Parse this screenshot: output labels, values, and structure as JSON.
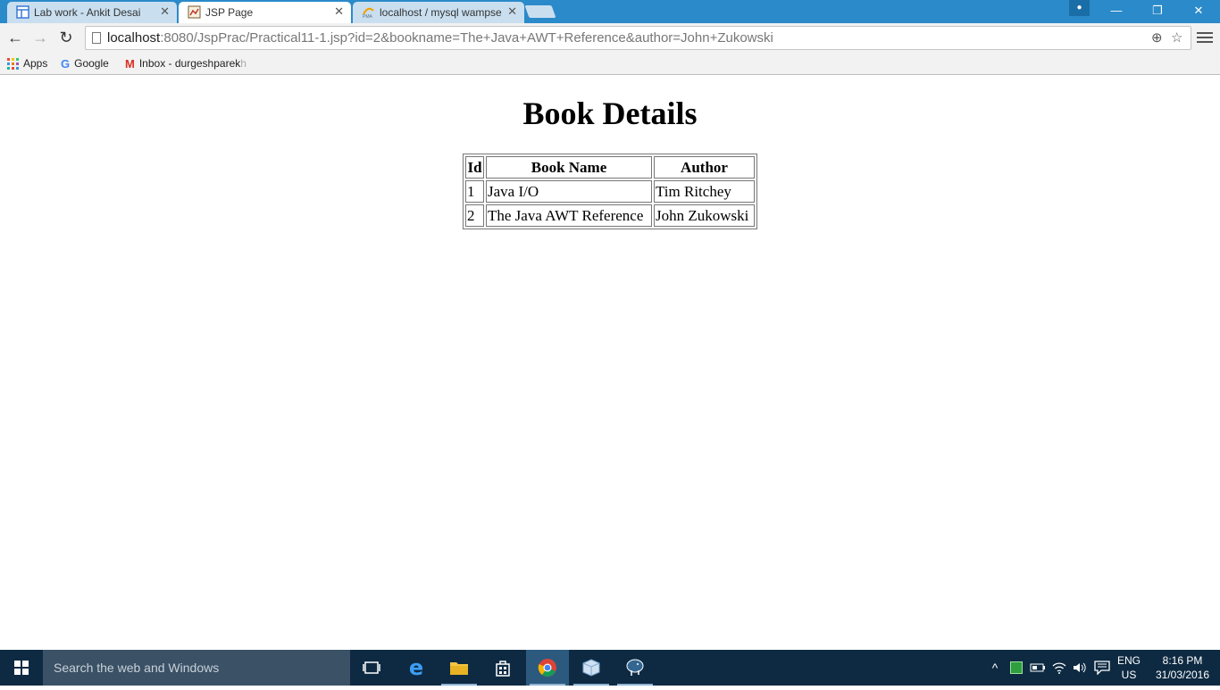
{
  "browser": {
    "tabs": [
      {
        "title": "Lab work - Ankit Desai",
        "icon": "docs-icon",
        "active": false
      },
      {
        "title": "JSP Page",
        "icon": "jsp-page-icon",
        "active": true
      },
      {
        "title": "localhost / mysql wampse",
        "icon": "phpmyadmin-icon",
        "active": false
      }
    ],
    "close_glyph": "✕",
    "window_controls": {
      "minimize": "—",
      "restore": "❐",
      "close": "✕"
    },
    "nav": {
      "back": "←",
      "forward": "→",
      "reload": "↻"
    },
    "url_host": "localhost",
    "url_rest": ":8080/JspPrac/Practical11-1.jsp?id=2&bookname=The+Java+AWT+Reference&author=John+Zukowski",
    "omnibox_icons": {
      "zoom": "⊕",
      "star": "☆"
    },
    "bookmarks": [
      {
        "label": "Apps",
        "icon": "apps-grid-icon"
      },
      {
        "label": "Google",
        "icon": "google-icon"
      },
      {
        "label": "Inbox - durgeshparek",
        "label_fade": "h",
        "icon": "gmail-icon"
      }
    ]
  },
  "page": {
    "heading": "Book Details",
    "table": {
      "headers": [
        "Id",
        "Book Name",
        "Author"
      ],
      "rows": [
        [
          "1",
          "Java I/O",
          "Tim Ritchey"
        ],
        [
          "2",
          "The Java AWT Reference",
          "John Zukowski"
        ]
      ]
    }
  },
  "taskbar": {
    "search_placeholder": "Search the web and Windows",
    "apps": [
      "task-view-icon",
      "edge-icon",
      "file-explorer-icon",
      "store-icon",
      "chrome-icon",
      "virtualbox-icon",
      "postgres-icon"
    ],
    "tray_caret": "^",
    "language": "ENG",
    "region": "US",
    "time": "8:16 PM",
    "date": "31/03/2016"
  },
  "colors": {
    "title_bar": "#2b8ac9",
    "taskbar": "#0e2a42",
    "search_box": "#3a5166"
  }
}
